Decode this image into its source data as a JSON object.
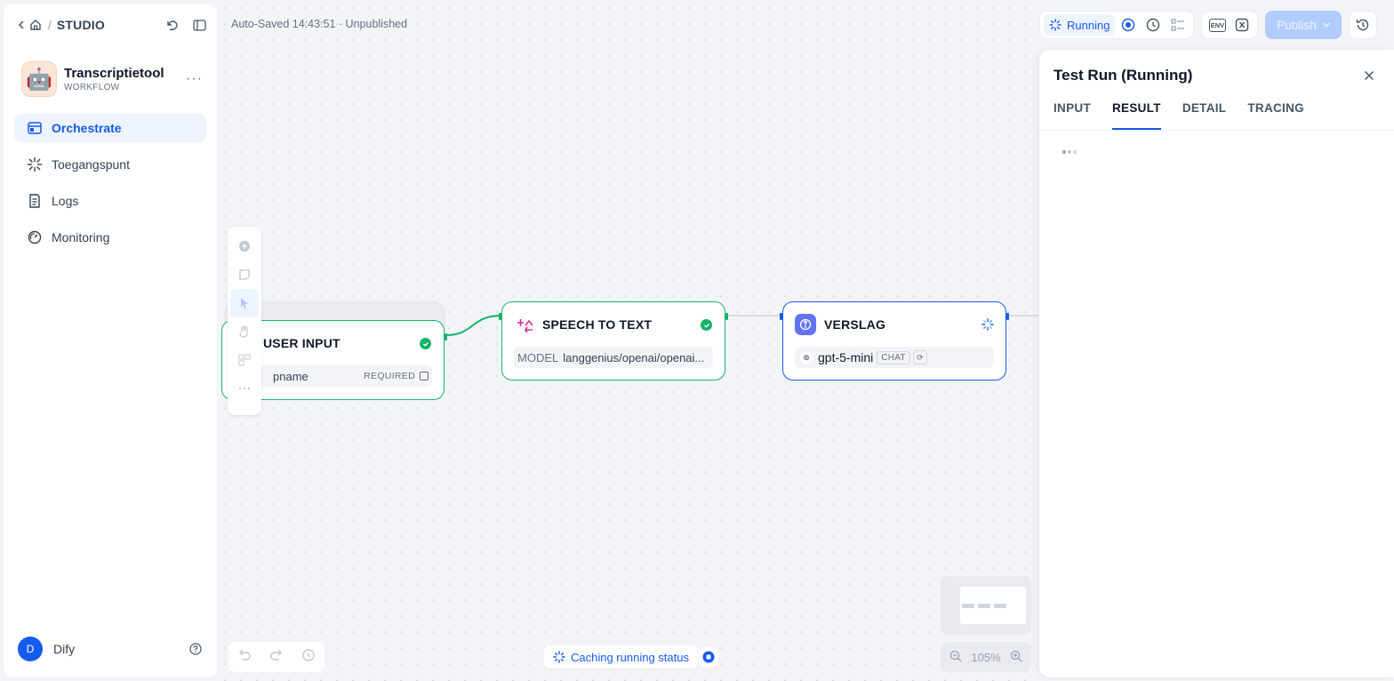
{
  "colors": {
    "accent": "#155aef",
    "success": "#17b26a",
    "nodeGreen": "#17b26a"
  },
  "breadcrumb": {
    "studio": "STUDIO"
  },
  "app": {
    "name": "Transcriptietool",
    "type": "WORKFLOW",
    "more": "···",
    "avatar_emoji": "🤖"
  },
  "nav": [
    {
      "label": "Orchestrate",
      "icon": "orchestrate-icon",
      "active": true
    },
    {
      "label": "Toegangspunt",
      "icon": "access-point-icon",
      "active": false
    },
    {
      "label": "Logs",
      "icon": "logs-icon",
      "active": false
    },
    {
      "label": "Monitoring",
      "icon": "monitoring-icon",
      "active": false
    }
  ],
  "user": {
    "initial": "D",
    "name": "Dify"
  },
  "canvas": {
    "autosave": "Auto-Saved 14:43:51 · Unpublished",
    "caching": "Caching running status",
    "zoom": "105%"
  },
  "nodes": {
    "user_input": {
      "title": "USER INPUT",
      "field": "pname",
      "required": "REQUIRED"
    },
    "speech": {
      "title": "SPEECH TO TEXT",
      "model_label": "MODEL",
      "model_value": "langgenius/openai/openai..."
    },
    "verslag": {
      "title": "VERSLAG",
      "model": "gpt-5-mini",
      "tag": "CHAT"
    }
  },
  "toolbar": {
    "running": "Running",
    "env": "ENV",
    "publish": "Publish"
  },
  "panel": {
    "title": "Test Run (Running)",
    "tabs": [
      "INPUT",
      "RESULT",
      "DETAIL",
      "TRACING"
    ],
    "active_tab": "RESULT"
  }
}
